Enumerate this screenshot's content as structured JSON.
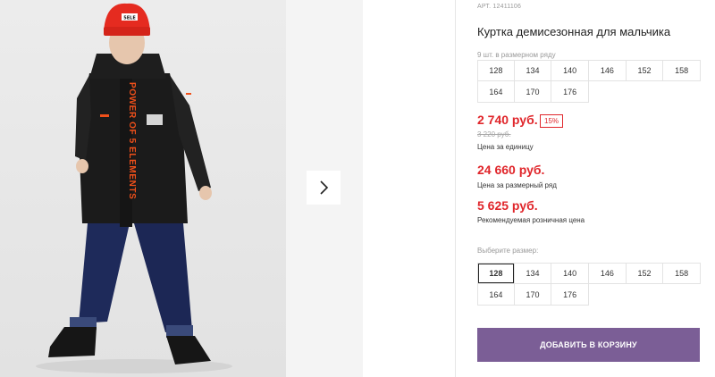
{
  "product": {
    "article": "АРТ. 12411106",
    "title": "Куртка демисезонная для мальчика",
    "row_label": "9 шт. в размерном ряду"
  },
  "size_row": [
    "128",
    "134",
    "140",
    "146",
    "152",
    "158",
    "164",
    "170",
    "176"
  ],
  "prices": {
    "current": "2 740 руб.",
    "discount_badge": "15%",
    "old": "3 220 руб.",
    "unit_caption": "Цена за единицу",
    "row_price": "24 660 руб.",
    "row_caption": "Цена за размерный ряд",
    "retail_price": "5 625 руб.",
    "retail_caption": "Рекомендуемая розничная цена"
  },
  "select": {
    "label": "Выберите размер:",
    "sizes": [
      "128",
      "134",
      "140",
      "146",
      "152",
      "158",
      "164",
      "170",
      "176"
    ],
    "selected": "128"
  },
  "cart_button": "ДОБАВИТЬ В КОРЗИНУ",
  "gallery": {
    "jacket_print": "POWER OF 5 ELEMENTS",
    "hat_label": "5ELE"
  },
  "colors": {
    "price_red": "#e0262b",
    "button_purple": "#7b5e96"
  }
}
